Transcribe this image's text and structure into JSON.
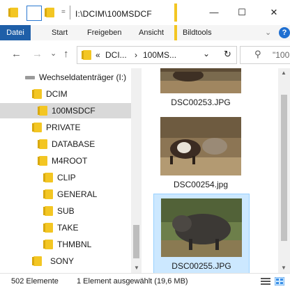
{
  "window": {
    "title": "I:\\DCIM\\100MSDCF",
    "minimize": "—",
    "maximize": "☐",
    "close": "✕"
  },
  "ribbon": {
    "tabs": [
      "Datei",
      "Start",
      "Freigeben",
      "Ansicht",
      "Bildtools"
    ]
  },
  "address": {
    "prefix": "«",
    "crumbs": [
      "DCI...",
      "100MS..."
    ],
    "separator": "›",
    "dropdown": "⌄",
    "refresh": "↻",
    "search_placeholder": "\"100"
  },
  "nav": {
    "back": "←",
    "forward": "→",
    "recent": "⌄",
    "up": "↑"
  },
  "tree": [
    {
      "label": "Wechseldatenträger (I:)",
      "icon": "usb-drive-icon",
      "indent": 0
    },
    {
      "label": "DCIM",
      "icon": "folder-icon",
      "indent": 1
    },
    {
      "label": "100MSDCF",
      "icon": "folder-icon",
      "indent": 2,
      "selected": true
    },
    {
      "label": "PRIVATE",
      "icon": "folder-icon",
      "indent": 1
    },
    {
      "label": "DATABASE",
      "icon": "folder-icon",
      "indent": 2
    },
    {
      "label": "M4ROOT",
      "icon": "folder-icon",
      "indent": 2
    },
    {
      "label": "CLIP",
      "icon": "folder-icon",
      "indent": 3
    },
    {
      "label": "GENERAL",
      "icon": "folder-icon",
      "indent": 3
    },
    {
      "label": "SUB",
      "icon": "folder-icon",
      "indent": 3
    },
    {
      "label": "TAKE",
      "icon": "folder-icon",
      "indent": 3
    },
    {
      "label": "THMBNL",
      "icon": "folder-icon",
      "indent": 3
    },
    {
      "label": "SONY",
      "icon": "folder-icon",
      "indent": 1
    }
  ],
  "files": [
    {
      "name": "DSC00253.JPG",
      "selected": false
    },
    {
      "name": "DSC00254.jpg",
      "selected": false
    },
    {
      "name": "DSC00255.JPG",
      "selected": true
    }
  ],
  "status": {
    "count": "502 Elemente",
    "selection": "1 Element ausgewählt (19,6 MB)"
  },
  "colors": {
    "accent": "#1f5fa8",
    "folder": "#f3c623",
    "selection_bg": "#cce8ff",
    "tree_selection": "#d9d9d9"
  }
}
